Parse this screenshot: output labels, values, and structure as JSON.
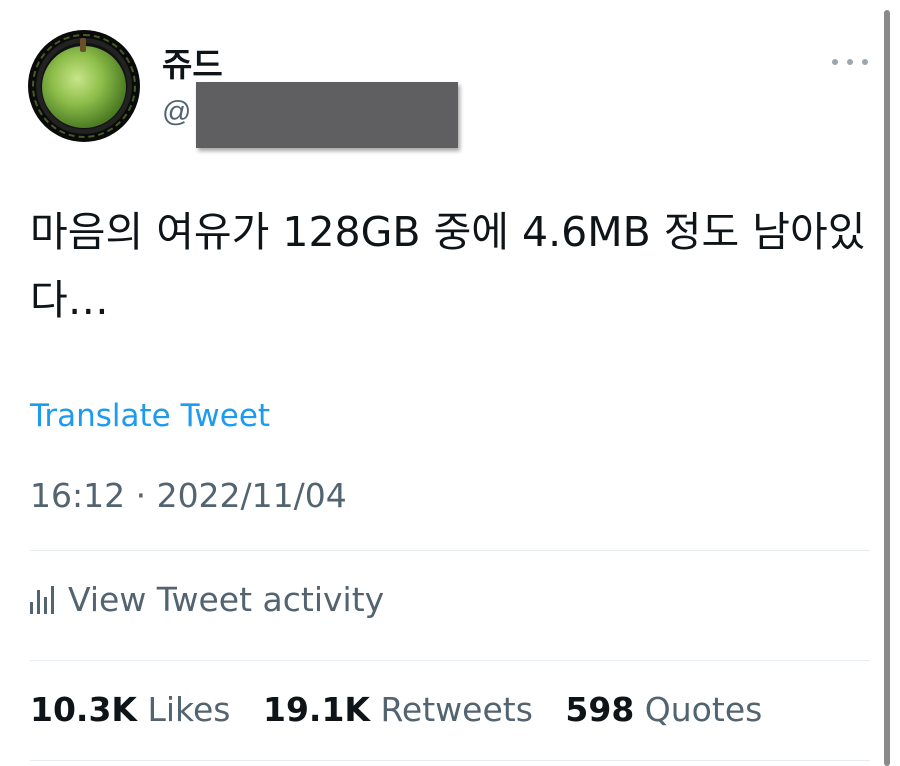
{
  "author": {
    "display_name": "쥬드",
    "handle_prefix": "@"
  },
  "tweet": {
    "text": "마음의 여유가 128GB 중에 4.6MB 정도 남아있다…",
    "translate_label": "Translate Tweet",
    "timestamp": "16:12 · 2022/11/04"
  },
  "activity": {
    "label": "View Tweet activity",
    "icon": "bar-chart-icon"
  },
  "stats": {
    "likes_count": "10.3K",
    "likes_label": "Likes",
    "retweets_count": "19.1K",
    "retweets_label": "Retweets",
    "quotes_count": "598",
    "quotes_label": "Quotes"
  },
  "colors": {
    "link": "#1d9bf0",
    "secondary_text": "#536471",
    "primary_text": "#0f1419",
    "redaction": "#5f5f62"
  }
}
